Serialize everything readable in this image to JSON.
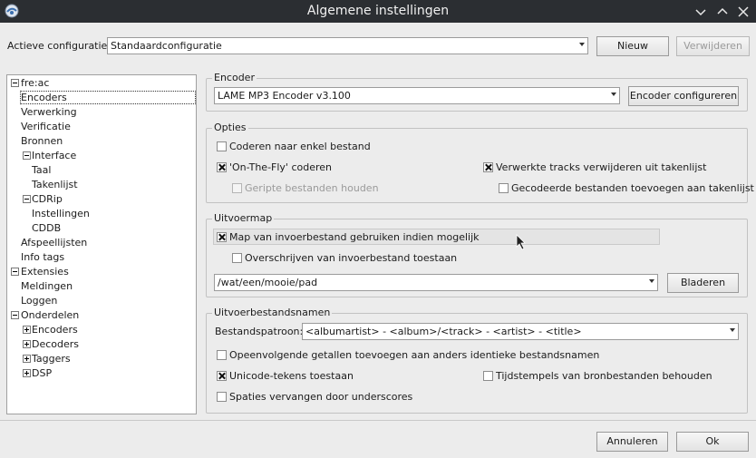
{
  "window": {
    "title": "Algemene instellingen"
  },
  "config": {
    "label": "Actieve configuratie:",
    "value": "Standaardconfiguratie",
    "new_label": "Nieuw",
    "delete_label": "Verwijderen"
  },
  "tree": {
    "root": "fre:ac",
    "encoders": "Encoders",
    "verwerking": "Verwerking",
    "verificatie": "Verificatie",
    "bronnen": "Bronnen",
    "interface": "Interface",
    "taal": "Taal",
    "takenlijst": "Takenlijst",
    "cdrip": "CDRip",
    "instellingen": "Instellingen",
    "cddb": "CDDB",
    "afspeellijsten": "Afspeellijsten",
    "infotags": "Info tags",
    "extensies": "Extensies",
    "meldingen": "Meldingen",
    "loggen": "Loggen",
    "onderdelen": "Onderdelen",
    "od_encoders": "Encoders",
    "od_decoders": "Decoders",
    "od_taggers": "Taggers",
    "od_dsp": "DSP"
  },
  "encoder": {
    "title": "Encoder",
    "value": "LAME MP3 Encoder v3.100",
    "configure_label": "Encoder configureren"
  },
  "options": {
    "title": "Opties",
    "single_file": "Coderen naar enkel bestand",
    "on_the_fly": "'On-The-Fly' coderen",
    "keep_ripped": "Geripte bestanden houden",
    "remove_processed": "Verwerkte tracks verwijderen uit takenlijst",
    "add_encoded": "Gecodeerde bestanden toevoegen aan takenlijst"
  },
  "output_dir": {
    "title": "Uitvoermap",
    "use_input_dir": "Map van invoerbestand gebruiken indien mogelijk",
    "allow_overwrite": "Overschrijven van invoerbestand toestaan",
    "path": "/wat/een/mooie/pad",
    "browse_label": "Bladeren"
  },
  "filenames": {
    "title": "Uitvoerbestandsnamen",
    "pattern_label": "Bestandspatroon:",
    "pattern_value": "<albumartist> - <album>/<track> - <artist> - <title>",
    "sequential": "Opeenvolgende getallen toevoegen aan anders identieke bestandsnamen",
    "unicode": "Unicode-tekens toestaan",
    "timestamps": "Tijdstempels van bronbestanden behouden",
    "underscores": "Spaties vervangen door underscores"
  },
  "footer": {
    "cancel_label": "Annuleren",
    "ok_label": "Ok"
  },
  "checked": {
    "single_file": false,
    "on_the_fly": true,
    "keep_ripped": false,
    "remove_processed": true,
    "add_encoded": false,
    "use_input_dir": true,
    "allow_overwrite": false,
    "sequential": false,
    "unicode": true,
    "timestamps": false,
    "underscores": false
  }
}
